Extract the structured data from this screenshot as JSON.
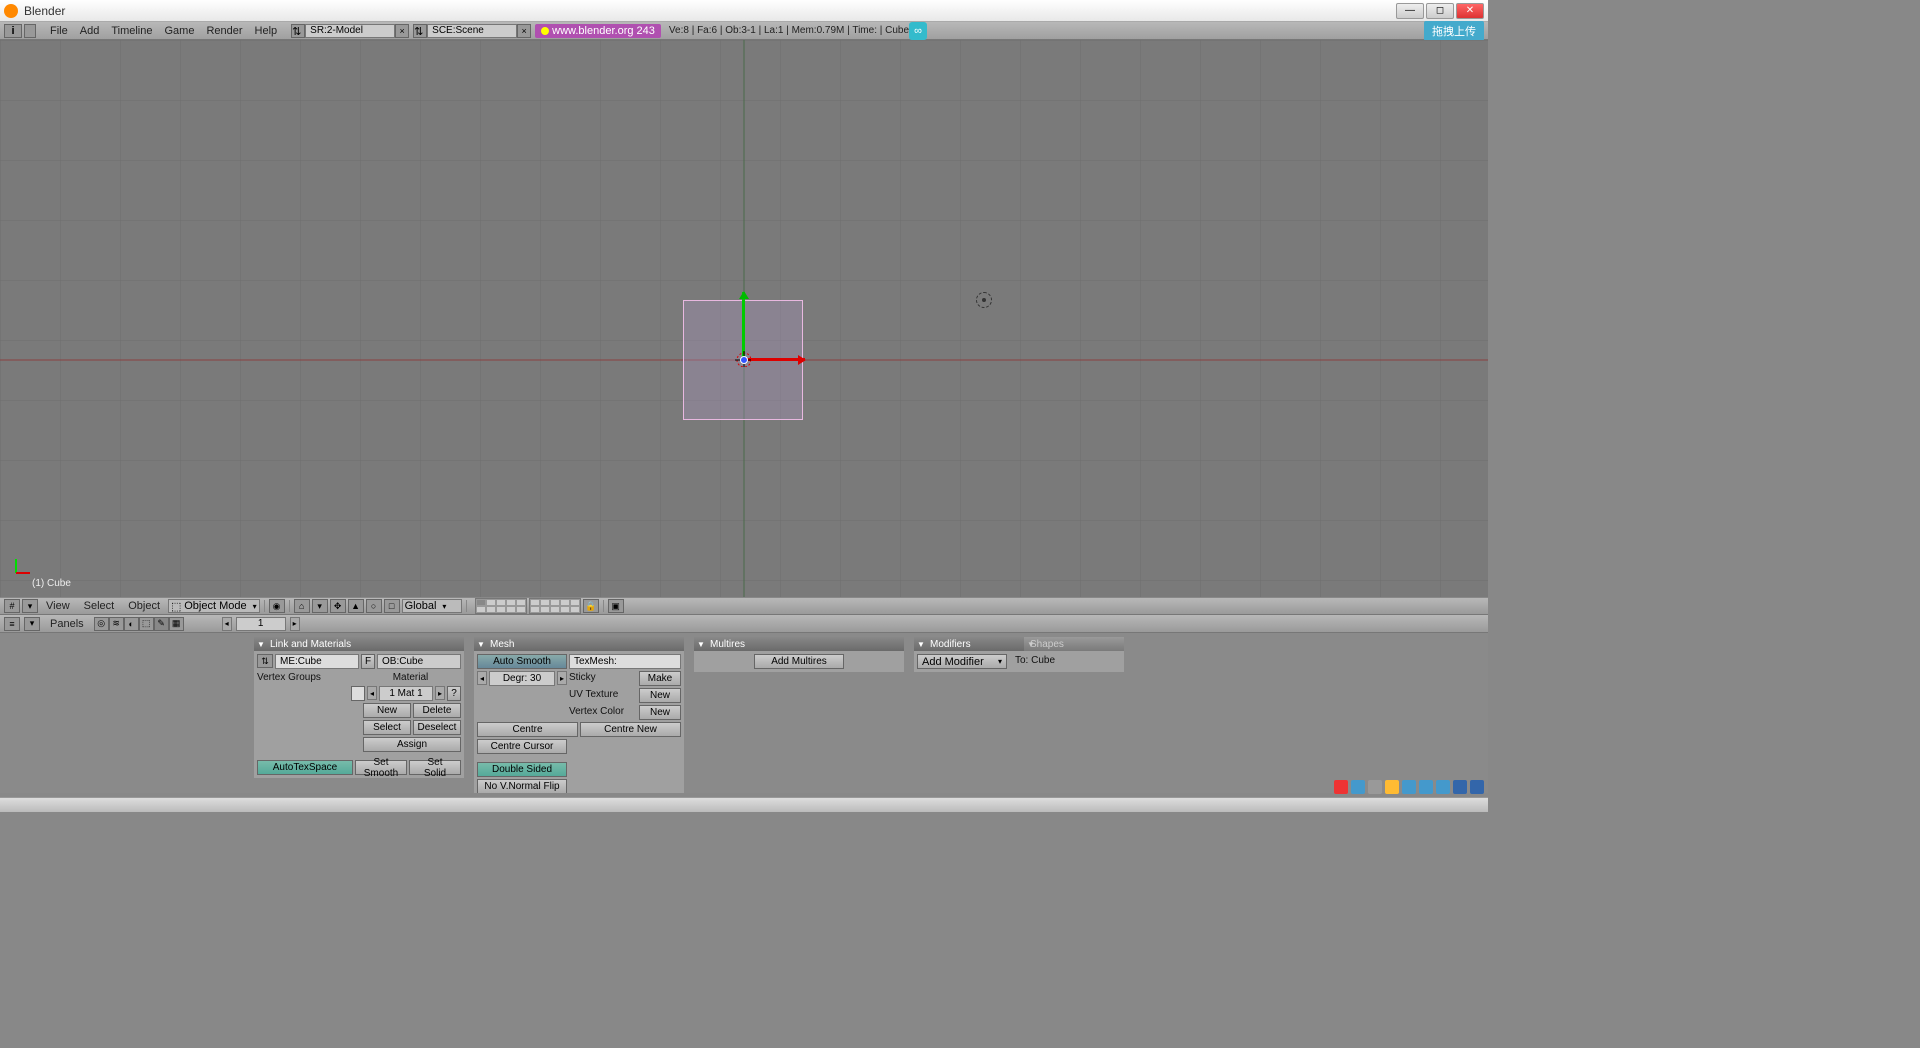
{
  "window": {
    "title": "Blender"
  },
  "menubar": {
    "items": [
      "File",
      "Add",
      "Timeline",
      "Game",
      "Render",
      "Help"
    ],
    "screen_sel": "SR:2-Model",
    "scene_sel": "SCE:Scene",
    "url": "www.blender.org 243",
    "stats": "Ve:8 | Fa:6 | Ob:3-1 | La:1 | Mem:0.79M | Time: | Cube",
    "rt_button": "拖拽上传"
  },
  "viewport": {
    "object_label": "(1) Cube",
    "header": {
      "menus": [
        "View",
        "Select",
        "Object"
      ],
      "mode": "Object Mode",
      "orientation": "Global"
    }
  },
  "btm_header": {
    "label": "Panels",
    "frame": "1"
  },
  "panels": {
    "link_materials": {
      "title": "Link and Materials",
      "mesh_field": "ME:Cube",
      "f_label": "F",
      "ob_field": "OB:Cube",
      "vg_label": "Vertex Groups",
      "mat_label": "Material",
      "mat_count": "1 Mat 1",
      "q": "?",
      "new": "New",
      "delete": "Delete",
      "select": "Select",
      "deselect": "Deselect",
      "assign": "Assign",
      "autotex": "AutoTexSpace",
      "setsmooth": "Set Smooth",
      "setsolid": "Set Solid"
    },
    "mesh": {
      "title": "Mesh",
      "autosmooth": "Auto Smooth",
      "degr": "Degr: 30",
      "texmesh": "TexMesh:",
      "sticky": "Sticky",
      "make": "Make",
      "uvtex": "UV Texture",
      "new1": "New",
      "vcolor": "Vertex Color",
      "new2": "New",
      "centre": "Centre",
      "centrenew": "Centre New",
      "centrecursor": "Centre Cursor",
      "doublesided": "Double Sided",
      "novnormal": "No V.Normal Flip"
    },
    "multires": {
      "title": "Multires",
      "add": "Add Multires"
    },
    "modifiers": {
      "title": "Modifiers",
      "shapes": "Shapes",
      "addmod": "Add Modifier",
      "to": "To: Cube"
    }
  }
}
